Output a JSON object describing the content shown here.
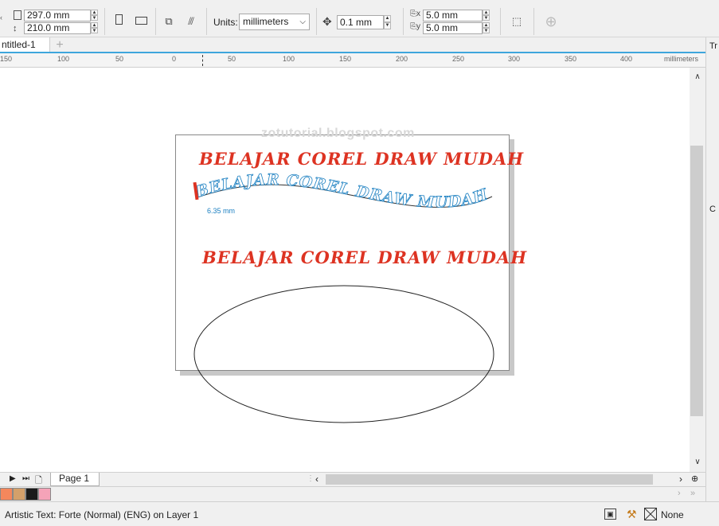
{
  "propbar": {
    "page_width": "297.0 mm",
    "page_height": "210.0 mm",
    "units_label": "Units:",
    "units_value": "millimeters",
    "nudge_value": "0.1 mm",
    "dup_x": "5.0 mm",
    "dup_y": "5.0 mm"
  },
  "tabs": {
    "document": "ntitled-1"
  },
  "ruler": {
    "unit": "millimeters",
    "ticks": [
      "150",
      "100",
      "50",
      "0",
      "50",
      "100",
      "150",
      "200",
      "250",
      "300",
      "350",
      "400"
    ]
  },
  "canvas": {
    "watermark": "zotutorial.blogspot.com",
    "text_line_1": "BELAJAR COREL DRAW MUDAH",
    "text_path": "BELAJAR COREL DRAW MUDAH",
    "text_path_offset": "6.35 mm",
    "text_line_3": "BELAJAR COREL DRAW MUDAH"
  },
  "pagenav": {
    "page_label": "Page 1"
  },
  "palette": {
    "colors": [
      "#f4875c",
      "#d4a06a",
      "#1a1a1a",
      "#f5a3b8"
    ]
  },
  "status": {
    "object_info": "Artistic Text: Forte (Normal) (ENG) on Layer 1",
    "outline_label": "None"
  },
  "colors": {
    "accent": "#3ea6dc",
    "text_red": "#dd3322",
    "path_text_blue": "#1a7fc1"
  }
}
